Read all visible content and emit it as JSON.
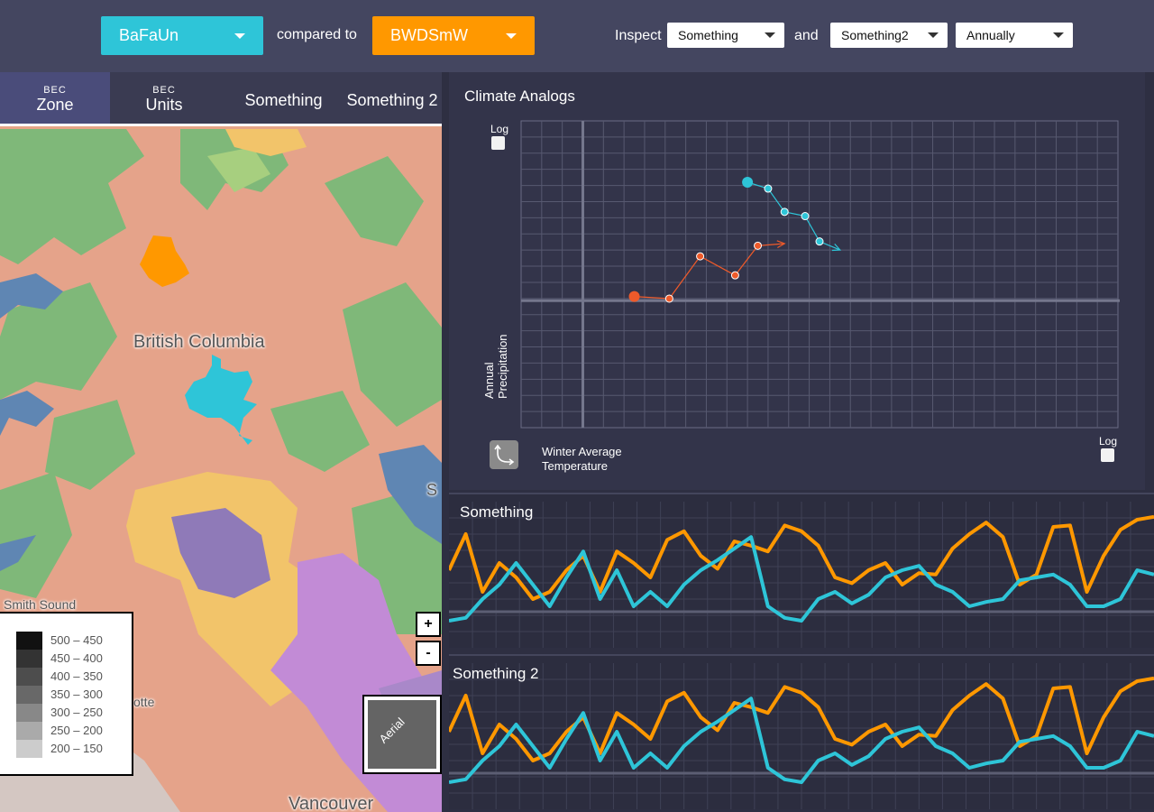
{
  "header": {
    "zone_a": "BaFaUn",
    "compared_to": "compared to",
    "zone_b": "BWDSmW",
    "inspect": "Inspect",
    "var1": "Something",
    "and": "and",
    "var2": "Something2",
    "period": "Annually"
  },
  "tabs": [
    {
      "small": "BEC",
      "big": "Zone"
    },
    {
      "small": "BEC",
      "big": "Units"
    },
    {
      "big": "Something"
    },
    {
      "big": "Something 2"
    }
  ],
  "map": {
    "region_label": "British Columbia",
    "label_sound": "Smith Sound",
    "label_vancouver": "Vancouver",
    "label_otte": "otte",
    "label_s": "S",
    "zoom_in": "+",
    "zoom_out": "-",
    "aerial": "Aerial",
    "colors": {
      "zone_a": "#2ec5d8",
      "zone_b": "#ff9800"
    }
  },
  "legend": [
    {
      "range": "500 – 450",
      "color": "#111111"
    },
    {
      "range": "450 – 400",
      "color": "#333333"
    },
    {
      "range": "400 – 350",
      "color": "#4d4d4d"
    },
    {
      "range": "350 – 300",
      "color": "#686868"
    },
    {
      "range": "300 – 250",
      "color": "#888888"
    },
    {
      "range": "250 – 200",
      "color": "#aaaaaa"
    },
    {
      "range": "200 – 150",
      "color": "#cccccc"
    }
  ],
  "analogs": {
    "title": "Climate Analogs",
    "log_y": "Log",
    "log_x": "Log",
    "ylabel_line1": "Annual",
    "ylabel_line2": "Precipitation",
    "xlabel_line1": "Winter Average",
    "xlabel_line2": "Temperature"
  },
  "chart_data": [
    {
      "type": "line",
      "title": "Climate Analogs",
      "xlabel": "Winter Average Temperature",
      "ylabel": "Annual Precipitation",
      "grid": true,
      "series": [
        {
          "color": "#ee5a2a",
          "x": [
            2.5,
            4.2,
            5.7,
            7.4,
            8.5,
            9.8
          ],
          "y": [
            0.2,
            0.1,
            2.1,
            1.2,
            2.6,
            2.7
          ]
        },
        {
          "color": "#2ec5d8",
          "x": [
            8.0,
            9.0,
            9.8,
            10.8,
            11.5,
            12.5
          ],
          "y": [
            5.6,
            5.3,
            4.2,
            4.0,
            2.8,
            2.4
          ]
        }
      ]
    },
    {
      "type": "line",
      "title": "Something",
      "grid": true,
      "series": [
        {
          "color": "#ff9800",
          "x": [
            0,
            1,
            2,
            3,
            4,
            5,
            6,
            7,
            8,
            9,
            10,
            11,
            12,
            13,
            14,
            15,
            16,
            17,
            18,
            19,
            20,
            21,
            22,
            23,
            24,
            25,
            26,
            27,
            28,
            29,
            30,
            31,
            32,
            33,
            34,
            35,
            36,
            37,
            38,
            39,
            40,
            41,
            42
          ],
          "y": [
            0.55,
            0.8,
            0.4,
            0.6,
            0.5,
            0.35,
            0.4,
            0.55,
            0.65,
            0.4,
            0.68,
            0.6,
            0.5,
            0.76,
            0.82,
            0.65,
            0.56,
            0.75,
            0.72,
            0.68,
            0.86,
            0.82,
            0.72,
            0.5,
            0.46,
            0.55,
            0.6,
            0.45,
            0.53,
            0.52,
            0.7,
            0.8,
            0.88,
            0.78,
            0.45,
            0.52,
            0.85,
            0.86,
            0.4,
            0.65,
            0.83,
            0.9,
            0.92
          ]
        },
        {
          "color": "#2ec5d8",
          "x": [
            0,
            1,
            2,
            3,
            4,
            5,
            6,
            7,
            8,
            9,
            10,
            11,
            12,
            13,
            14,
            15,
            16,
            17,
            18,
            19,
            20,
            21,
            22,
            23,
            24,
            25,
            26,
            27,
            28,
            29,
            30,
            31,
            32,
            33,
            34,
            35,
            36,
            37,
            38,
            39,
            40,
            41,
            42
          ],
          "y": [
            0.2,
            0.22,
            0.35,
            0.45,
            0.6,
            0.45,
            0.3,
            0.5,
            0.68,
            0.35,
            0.55,
            0.3,
            0.4,
            0.3,
            0.45,
            0.55,
            0.62,
            0.7,
            0.78,
            0.3,
            0.22,
            0.2,
            0.35,
            0.4,
            0.32,
            0.38,
            0.5,
            0.55,
            0.58,
            0.45,
            0.4,
            0.3,
            0.33,
            0.35,
            0.48,
            0.5,
            0.52,
            0.45,
            0.3,
            0.3,
            0.35,
            0.55,
            0.52
          ]
        }
      ]
    },
    {
      "type": "line",
      "title": "Something 2",
      "grid": true,
      "series": [
        {
          "color": "#ff9800",
          "x": [
            0,
            1,
            2,
            3,
            4,
            5,
            6,
            7,
            8,
            9,
            10,
            11,
            12,
            13,
            14,
            15,
            16,
            17,
            18,
            19,
            20,
            21,
            22,
            23,
            24,
            25,
            26,
            27,
            28,
            29,
            30,
            31,
            32,
            33,
            34,
            35,
            36,
            37,
            38,
            39,
            40,
            41,
            42
          ],
          "y": [
            0.55,
            0.8,
            0.4,
            0.6,
            0.5,
            0.35,
            0.4,
            0.55,
            0.65,
            0.4,
            0.68,
            0.6,
            0.5,
            0.76,
            0.82,
            0.65,
            0.56,
            0.75,
            0.72,
            0.68,
            0.86,
            0.82,
            0.72,
            0.5,
            0.46,
            0.55,
            0.6,
            0.45,
            0.53,
            0.52,
            0.7,
            0.8,
            0.88,
            0.78,
            0.45,
            0.52,
            0.85,
            0.86,
            0.4,
            0.65,
            0.83,
            0.9,
            0.92
          ]
        },
        {
          "color": "#2ec5d8",
          "x": [
            0,
            1,
            2,
            3,
            4,
            5,
            6,
            7,
            8,
            9,
            10,
            11,
            12,
            13,
            14,
            15,
            16,
            17,
            18,
            19,
            20,
            21,
            22,
            23,
            24,
            25,
            26,
            27,
            28,
            29,
            30,
            31,
            32,
            33,
            34,
            35,
            36,
            37,
            38,
            39,
            40,
            41,
            42
          ],
          "y": [
            0.2,
            0.22,
            0.35,
            0.45,
            0.6,
            0.45,
            0.3,
            0.5,
            0.68,
            0.35,
            0.55,
            0.3,
            0.4,
            0.3,
            0.45,
            0.55,
            0.62,
            0.7,
            0.78,
            0.3,
            0.22,
            0.2,
            0.35,
            0.4,
            0.32,
            0.38,
            0.5,
            0.55,
            0.58,
            0.45,
            0.4,
            0.3,
            0.33,
            0.35,
            0.48,
            0.5,
            0.52,
            0.45,
            0.3,
            0.3,
            0.35,
            0.55,
            0.52
          ]
        }
      ]
    }
  ]
}
